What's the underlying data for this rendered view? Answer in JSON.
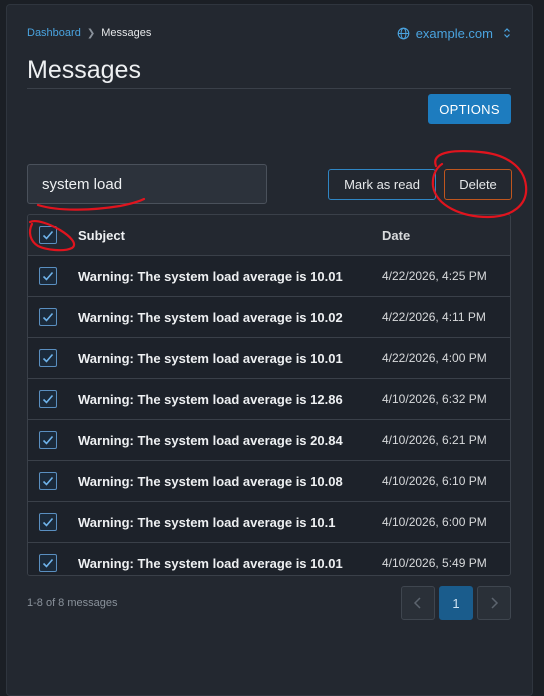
{
  "breadcrumb": {
    "parent": "Dashboard",
    "current": "Messages"
  },
  "site_switcher": {
    "label": "example.com",
    "icon": "globe-icon"
  },
  "page": {
    "title": "Messages"
  },
  "toolbar": {
    "options_label": "OPTIONS",
    "mark_read_label": "Mark as read",
    "delete_label": "Delete"
  },
  "search": {
    "value": "system load"
  },
  "table": {
    "headers": {
      "subject": "Subject",
      "date": "Date"
    },
    "rows": [
      {
        "subject": "Warning: The system load average is 10.01",
        "date": "4/22/2026, 4:25 PM",
        "checked": true
      },
      {
        "subject": "Warning: The system load average is 10.02",
        "date": "4/22/2026, 4:11 PM",
        "checked": true
      },
      {
        "subject": "Warning: The system load average is 10.01",
        "date": "4/22/2026, 4:00 PM",
        "checked": true
      },
      {
        "subject": "Warning: The system load average is 12.86",
        "date": "4/10/2026, 6:32 PM",
        "checked": true
      },
      {
        "subject": "Warning: The system load average is 20.84",
        "date": "4/10/2026, 6:21 PM",
        "checked": true
      },
      {
        "subject": "Warning: The system load average is 10.08",
        "date": "4/10/2026, 6:10 PM",
        "checked": true
      },
      {
        "subject": "Warning: The system load average is 10.1",
        "date": "4/10/2026, 6:00 PM",
        "checked": true
      },
      {
        "subject": "Warning: The system load average is 10.01",
        "date": "4/10/2026, 5:49 PM",
        "checked": true
      }
    ]
  },
  "footer": {
    "count_text": "1-8 of 8 messages"
  },
  "pagination": {
    "current_page": "1"
  },
  "colors": {
    "accent": "#4aa3df",
    "primary_button": "#1d7cbf",
    "danger_border": "#c0561e",
    "annotation": "#e0141e"
  }
}
